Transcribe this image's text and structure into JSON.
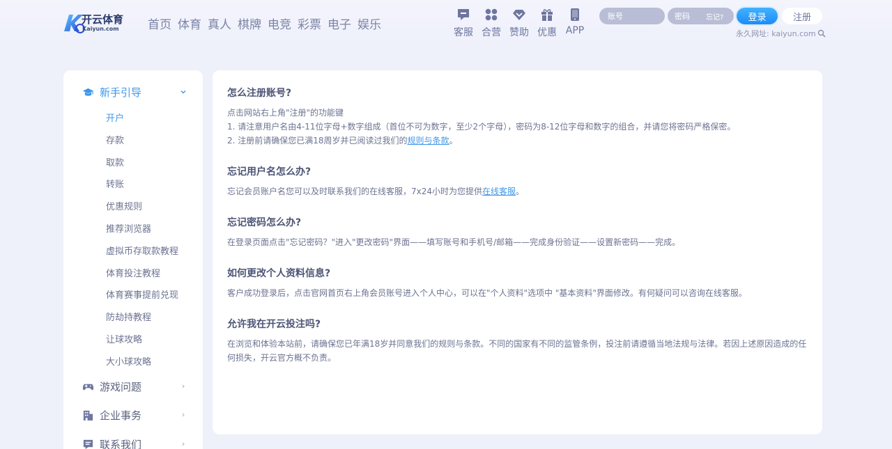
{
  "brand": {
    "name": "开云体育",
    "sub": "Kaiyun.com",
    "mark": "K"
  },
  "nav": [
    {
      "label": "首页"
    },
    {
      "label": "体育"
    },
    {
      "label": "真人"
    },
    {
      "label": "棋牌"
    },
    {
      "label": "电竞"
    },
    {
      "label": "彩票"
    },
    {
      "label": "电子"
    },
    {
      "label": "娱乐"
    }
  ],
  "tools": [
    {
      "label": "客服",
      "icon": "chat-icon"
    },
    {
      "label": "合营",
      "icon": "grid-icon"
    },
    {
      "label": "赞助",
      "icon": "diamond-icon"
    },
    {
      "label": "优惠",
      "icon": "gift-icon"
    },
    {
      "label": "APP",
      "icon": "phone-icon"
    }
  ],
  "login": {
    "account_placeholder": "账号",
    "password_placeholder": "密码",
    "forgot": "忘记?",
    "login_btn": "登录",
    "register_btn": "注册",
    "permanent": "永久网址: kaiyun.com"
  },
  "sidebar": {
    "groups": [
      {
        "title": "新手引导",
        "icon": "graduation-cap-icon",
        "active": true
      },
      {
        "title": "游戏问题",
        "icon": "gamepad-icon"
      },
      {
        "title": "企业事务",
        "icon": "building-icon"
      },
      {
        "title": "联系我们",
        "icon": "message-icon"
      }
    ],
    "sub_items": [
      {
        "label": "开户",
        "active": true
      },
      {
        "label": "存款"
      },
      {
        "label": "取款"
      },
      {
        "label": "转账"
      },
      {
        "label": "优惠规则"
      },
      {
        "label": "推荐浏览器"
      },
      {
        "label": "虚拟币存取款教程"
      },
      {
        "label": "体育投注教程"
      },
      {
        "label": "体育赛事提前兑现"
      },
      {
        "label": "防劫持教程"
      },
      {
        "label": "让球攻略"
      },
      {
        "label": "大小球攻略"
      }
    ]
  },
  "faq": [
    {
      "title": "怎么注册账号?",
      "lines": [
        "点击网站右上角\"注册\"的功能键",
        "1. 请注意用户名由4-11位字母+数字组成（首位不可为数字，至少2个字母），密码为8-12位字母和数字的组合，并请您将密码严格保密。"
      ],
      "last_prefix": "2. 注册前请确保您已满18周岁并已阅读过我们的",
      "last_link": "规则与条款",
      "last_suffix": "。"
    },
    {
      "title": "忘记用户名怎么办?",
      "prefix": "忘记会员账户名您可以及时联系我们的在线客服，7x24小时为您提供",
      "link": "在线客服",
      "suffix": "。"
    },
    {
      "title": "忘记密码怎么办?",
      "text": "在登录页面点击\"忘记密码？\"进入\"更改密码\"界面——填写账号和手机号/邮箱——完成身份验证——设置新密码——完成。"
    },
    {
      "title": "如何更改个人资料信息?",
      "text": "客户成功登录后，点击官网首页右上角会员账号进入个人中心，可以在\"个人资料\"选项中 \"基本资料\"界面修改。有何疑问可以咨询在线客服。"
    },
    {
      "title": "允许我在开云投注吗?",
      "text": "在浏览和体验本站前，请确保您已年满18岁并同意我们的规则与条款。不同的国家有不同的监管条例，投注前请遵循当地法规与法律。若因上述原因造成的任何损失，开云官方概不负责。"
    }
  ],
  "colors": {
    "accent": "#3f97e8",
    "page_bg": "#eef0fa",
    "icon": "#6e76a0"
  }
}
